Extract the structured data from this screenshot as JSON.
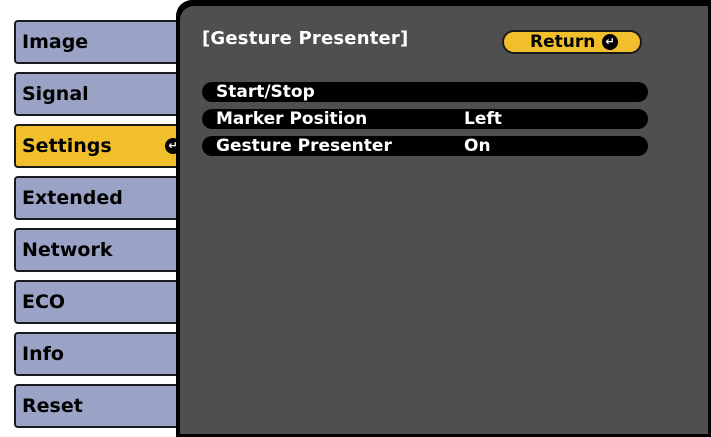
{
  "sidebar": {
    "items": [
      {
        "label": "Image"
      },
      {
        "label": "Signal"
      },
      {
        "label": "Settings"
      },
      {
        "label": "Extended"
      },
      {
        "label": "Network"
      },
      {
        "label": "ECO"
      },
      {
        "label": "Info"
      },
      {
        "label": "Reset"
      }
    ],
    "active_index": 2
  },
  "panel": {
    "title": "[Gesture Presenter]",
    "return_label": "Return",
    "rows": [
      {
        "label": "Start/Stop",
        "value": ""
      },
      {
        "label": "Marker Position",
        "value": "Left"
      },
      {
        "label": "Gesture Presenter",
        "value": "On"
      }
    ]
  },
  "icons": {
    "enter": "enter-icon"
  },
  "colors": {
    "menu_inactive": "#9aa3c6",
    "menu_active": "#f2bf2c",
    "panel_bg": "#4f4f4f",
    "row_bg": "#000000",
    "text_light": "#ffffff"
  }
}
